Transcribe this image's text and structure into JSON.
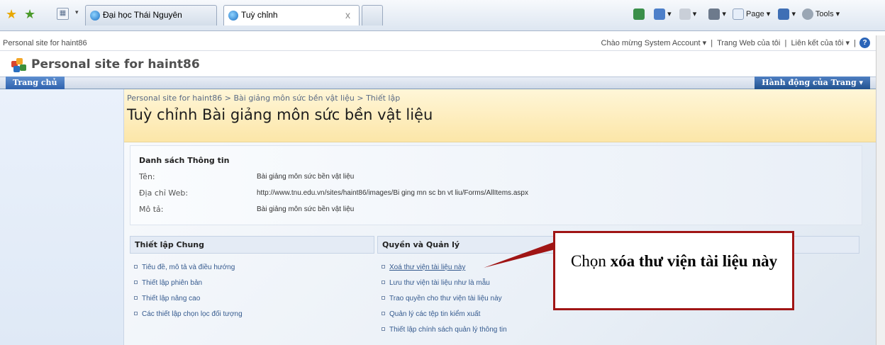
{
  "browser": {
    "tabs": [
      {
        "label": "Đại học Thái Nguyên"
      },
      {
        "label": "Tuỳ chỉnh"
      }
    ],
    "close_glyph": "x",
    "toolbar": {
      "page": "Page",
      "tools": "Tools"
    }
  },
  "topbar": {
    "site_label": "Personal site for haint86",
    "welcome": "Chào mừng System Account",
    "my_site": "Trang Web của tôi",
    "my_links": "Liên kết của tôi"
  },
  "site": {
    "title": "Personal site for haint86"
  },
  "nav": {
    "home_tab": "Trang chủ",
    "site_actions": "Hành động của Trang"
  },
  "page": {
    "breadcrumb": "Personal site for haint86 > Bài giảng môn sức bền vật liệu > Thiết lập",
    "title": "Tuỳ chỉnh Bài giảng môn sức bền vật liệu"
  },
  "info": {
    "heading": "Danh sách Thông tin",
    "name_label": "Tên:",
    "name_value": "Bài giảng môn sức bền vật liệu",
    "url_label": "Địa chỉ Web:",
    "url_value": "http://www.tnu.edu.vn/sites/haint86/images/Bi ging mn sc bn vt liu/Forms/AllItems.aspx",
    "desc_label": "Mô tả:",
    "desc_value": "Bài giảng môn sức bền vật liệu"
  },
  "general_settings": {
    "heading": "Thiết lập Chung",
    "items": [
      "Tiêu đề, mô tả và điều hướng",
      "Thiết lập phiên bản",
      "Thiết lập nâng cao",
      "Các thiết lập chọn lọc đối tượng"
    ]
  },
  "permissions": {
    "heading": "Quyền và Quản lý",
    "items": [
      "Xoá thư viện tài liệu này",
      "Lưu thư viện tài liệu như là mẫu",
      "Trao quyền cho thư viện tài liệu này",
      "Quản lý các tệp tin kiểm xuất",
      "Thiết lập chính sách quản lý thông tin"
    ]
  },
  "callout": {
    "prefix": "Chọn ",
    "bold": "xóa thư viện tài liệu này"
  },
  "colors": {
    "callout_border": "#a01515",
    "nav_tab": "#2f62ad",
    "title_bg": "#fce6a8"
  }
}
